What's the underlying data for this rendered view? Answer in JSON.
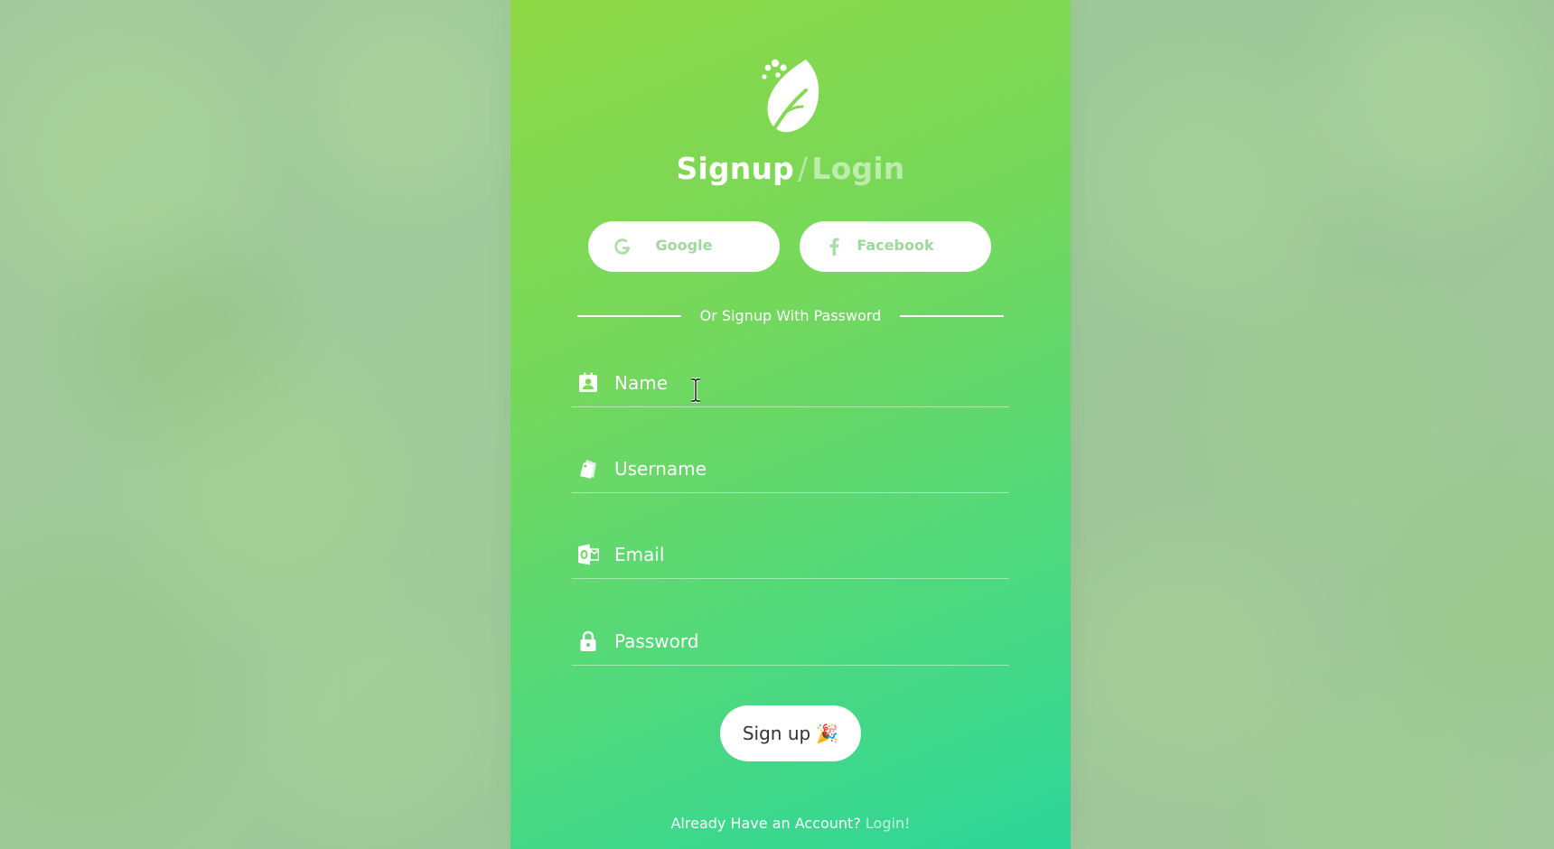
{
  "header": {
    "logo_icon": "leaf-icon",
    "title_signup": "Signup",
    "title_separator": "/",
    "title_login": "Login"
  },
  "social": {
    "google": {
      "label": "Google",
      "icon": "google-g-icon"
    },
    "facebook": {
      "label": "Facebook",
      "icon": "facebook-f-icon"
    }
  },
  "divider_text": "Or Signup With Password",
  "form": {
    "name": {
      "placeholder": "Name",
      "icon": "contact-card-icon"
    },
    "username": {
      "placeholder": "Username",
      "icon": "tag-icon"
    },
    "email": {
      "placeholder": "Email",
      "icon": "outlook-mail-icon"
    },
    "password": {
      "placeholder": "Password",
      "icon": "lock-icon"
    }
  },
  "submit": {
    "label": "Sign up",
    "emoji": "🎉"
  },
  "footer": {
    "prompt": "Already Have an Account?",
    "link": "Login!"
  },
  "colors": {
    "card_gradient_start": "#8fd845",
    "card_gradient_end": "#2cd69a",
    "social_text": "#9ed89a",
    "background": "#a2c99c"
  }
}
